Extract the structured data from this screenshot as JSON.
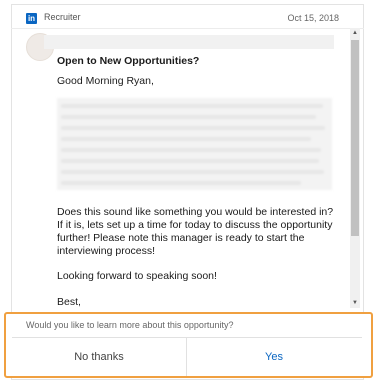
{
  "header": {
    "logo_text": "in",
    "sender": "Recruiter",
    "date": "Oct 15, 2018"
  },
  "message": {
    "subject": "Open to New Opportunities?",
    "greeting": "Good Morning Ryan,",
    "body": "Does this sound like something you would be interested in? If it is, lets set up a time for today to discuss the opportunity further! Please note this manager is ready to start the interviewing process!",
    "closing": "Looking forward to speaking soon!",
    "signoff": "Best,"
  },
  "prompt": {
    "question": "Would you like to learn more about this opportunity?",
    "decline_label": "No thanks",
    "accept_label": "Yes"
  },
  "colors": {
    "accent": "#0a66c2",
    "highlight": "#f0a040"
  }
}
